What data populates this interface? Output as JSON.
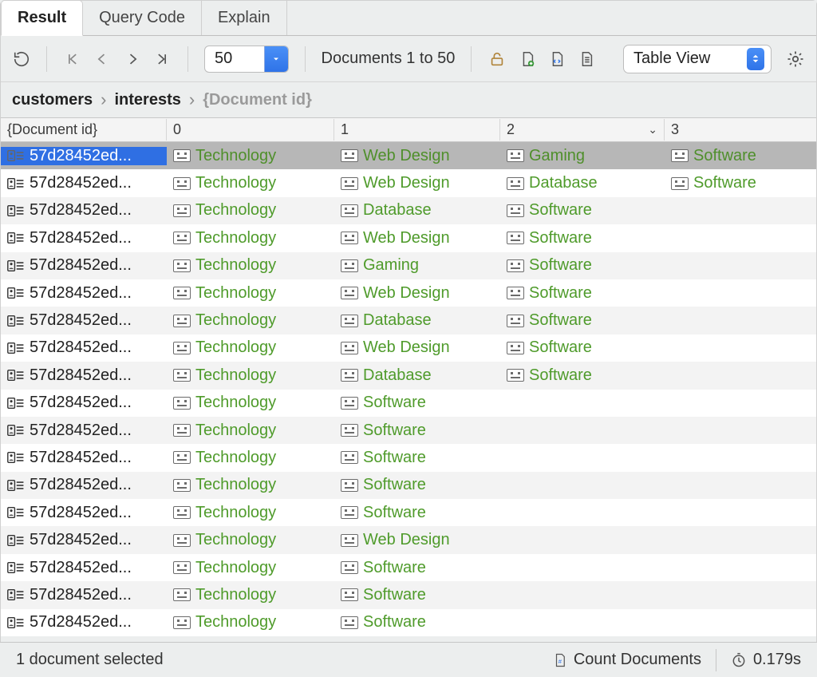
{
  "tabs": {
    "result": "Result",
    "query_code": "Query Code",
    "explain": "Explain",
    "active": "result"
  },
  "toolbar": {
    "page_size": "50",
    "doc_range": "Documents 1 to 50",
    "view_mode": "Table View"
  },
  "breadcrumb": {
    "items": [
      "customers",
      "interests",
      "{Document id}"
    ]
  },
  "columns": {
    "id": "{Document id}",
    "c0": "0",
    "c1": "1",
    "c2": "2",
    "c3": "3",
    "sorted": "c2"
  },
  "rows": [
    {
      "id": "57d28452ed...",
      "c0": "Technology",
      "c1": "Web Design",
      "c2": "Gaming",
      "c3": "Software",
      "selected": true
    },
    {
      "id": "57d28452ed...",
      "c0": "Technology",
      "c1": "Web Design",
      "c2": "Database",
      "c3": "Software"
    },
    {
      "id": "57d28452ed...",
      "c0": "Technology",
      "c1": "Database",
      "c2": "Software"
    },
    {
      "id": "57d28452ed...",
      "c0": "Technology",
      "c1": "Web Design",
      "c2": "Software"
    },
    {
      "id": "57d28452ed...",
      "c0": "Technology",
      "c1": "Gaming",
      "c2": "Software"
    },
    {
      "id": "57d28452ed...",
      "c0": "Technology",
      "c1": "Web Design",
      "c2": "Software"
    },
    {
      "id": "57d28452ed...",
      "c0": "Technology",
      "c1": "Database",
      "c2": "Software"
    },
    {
      "id": "57d28452ed...",
      "c0": "Technology",
      "c1": "Web Design",
      "c2": "Software"
    },
    {
      "id": "57d28452ed...",
      "c0": "Technology",
      "c1": "Database",
      "c2": "Software"
    },
    {
      "id": "57d28452ed...",
      "c0": "Technology",
      "c1": "Software"
    },
    {
      "id": "57d28452ed...",
      "c0": "Technology",
      "c1": "Software"
    },
    {
      "id": "57d28452ed...",
      "c0": "Technology",
      "c1": "Software"
    },
    {
      "id": "57d28452ed...",
      "c0": "Technology",
      "c1": "Software"
    },
    {
      "id": "57d28452ed...",
      "c0": "Technology",
      "c1": "Software"
    },
    {
      "id": "57d28452ed...",
      "c0": "Technology",
      "c1": "Web Design"
    },
    {
      "id": "57d28452ed...",
      "c0": "Technology",
      "c1": "Software"
    },
    {
      "id": "57d28452ed...",
      "c0": "Technology",
      "c1": "Software"
    },
    {
      "id": "57d28452ed...",
      "c0": "Technology",
      "c1": "Software"
    }
  ],
  "status": {
    "left": "1 document selected",
    "count_label": "Count Documents",
    "time": "0.179s"
  }
}
